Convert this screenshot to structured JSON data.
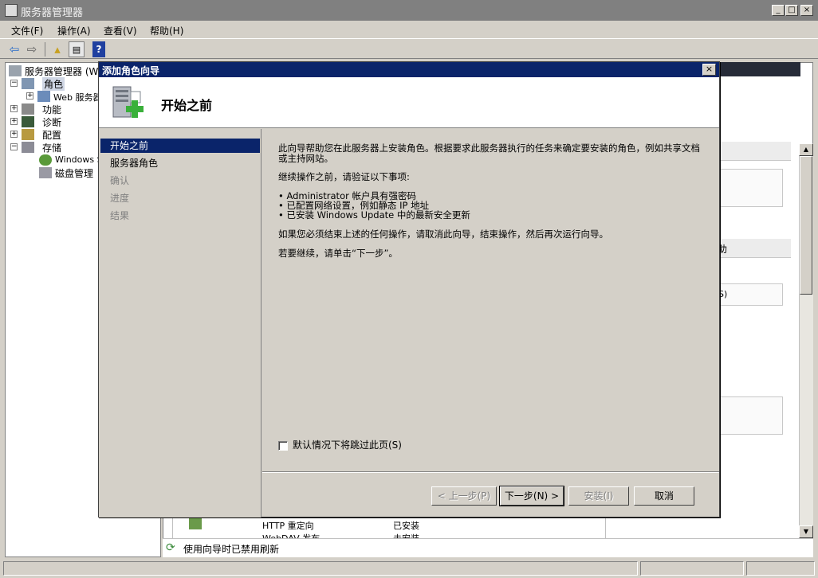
{
  "window": {
    "title": "服务器管理器",
    "min": "_",
    "max": "□",
    "close": "×"
  },
  "menu": [
    "文件(F)",
    "操作(A)",
    "查看(V)",
    "帮助(H)"
  ],
  "tree": {
    "root": "服务器管理器 (W",
    "items": [
      {
        "label": "角色",
        "expander": "⊟",
        "selected": true
      },
      {
        "label": "Web 服务器",
        "expander": "⊞",
        "indent": 1
      },
      {
        "label": "功能",
        "expander": "⊞"
      },
      {
        "label": "诊断",
        "expander": "⊞"
      },
      {
        "label": "配置",
        "expander": "⊞"
      },
      {
        "label": "存储",
        "expander": "⊟"
      },
      {
        "label": "Windows S",
        "indent": 1
      },
      {
        "label": "磁盘管理",
        "indent": 1
      }
    ]
  },
  "background": {
    "frag_help": "助",
    "frag_s": "S)",
    "row1": {
      "name": "HTTP 重定向",
      "status": "已安装"
    },
    "row2": {
      "name": "WebDAV 发布",
      "status": "未安装"
    },
    "status_text": "使用向导时已禁用刷新"
  },
  "dialog": {
    "title": "添加角色向导",
    "close": "×",
    "banner_title": "开始之前",
    "nav": [
      {
        "label": "开始之前",
        "state": "active"
      },
      {
        "label": "服务器角色",
        "state": "normal"
      },
      {
        "label": "确认",
        "state": "disabled"
      },
      {
        "label": "进度",
        "state": "disabled"
      },
      {
        "label": "结果",
        "state": "disabled"
      }
    ],
    "intro": "此向导帮助您在此服务器上安装角色。根据要求此服务器执行的任务来确定要安装的角色，例如共享文档或主持网站。",
    "verify_heading": "继续操作之前，请验证以下事项:",
    "bullets": [
      "• Administrator 帐户具有强密码",
      "• 已配置网络设置，例如静态 IP 地址",
      "• 已安装 Windows Update 中的最新安全更新"
    ],
    "cancel_note": "如果您必须结束上述的任何操作，请取消此向导，结束操作，然后再次运行向导。",
    "continue_note": "若要继续，请单击“下一步”。",
    "skip_checkbox": "默认情况下将跳过此页(S)",
    "buttons": {
      "back": "< 上一步(P)",
      "next": "下一步(N) >",
      "install": "安装(I)",
      "cancel": "取消"
    }
  }
}
